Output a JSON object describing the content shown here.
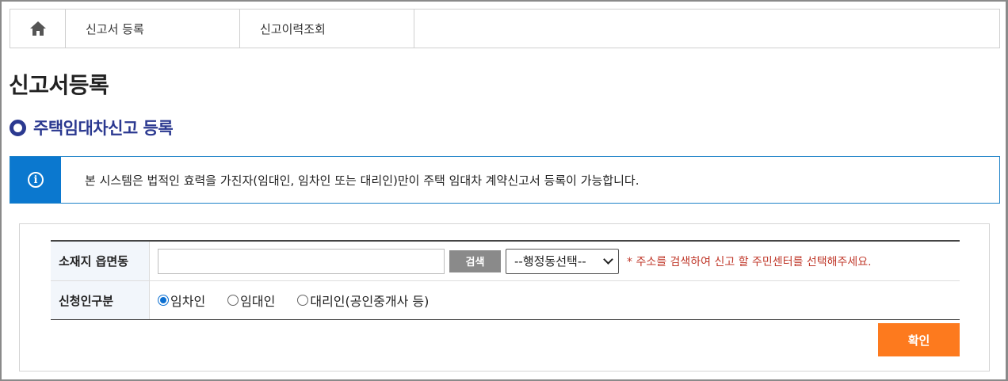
{
  "nav": {
    "home_icon": "home-icon",
    "tabs": [
      {
        "label": "신고서 등록"
      },
      {
        "label": "신고이력조회"
      }
    ]
  },
  "page": {
    "title": "신고서등록",
    "section_title": "주택임대차신고 등록"
  },
  "notice": {
    "icon": "info-icon",
    "icon_glyph": "i",
    "text": "본 시스템은 법적인 효력을 가진자(임대인, 임차인 또는 대리인)만이 주택 임대차 계약신고서 등록이 가능합니다."
  },
  "form": {
    "location": {
      "label": "소재지 읍면동",
      "input_value": "",
      "search_label": "검색",
      "select_value": "--행정동선택--",
      "hint": "* 주소를 검색하여 신고 할 주민센터를 선택해주세요."
    },
    "applicant": {
      "label": "신청인구분",
      "options": [
        {
          "label": "임차인",
          "selected": true
        },
        {
          "label": "임대인",
          "selected": false
        },
        {
          "label": "대리인(공인중개사 등)",
          "selected": false
        }
      ]
    },
    "confirm_label": "확인"
  },
  "colors": {
    "accent_blue": "#2b3990",
    "info_blue": "#0b78cf",
    "confirm_orange": "#fd7a1e",
    "hint_red": "#c0392b"
  }
}
